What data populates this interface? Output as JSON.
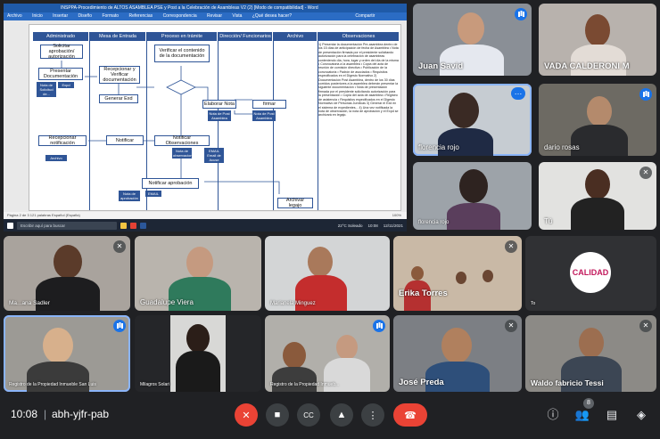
{
  "shared_screen": {
    "window_title": "INSPPA-Procedimiento de ALTOS ASAMBLEA PSE y Post a la Celebración de Asambleas V2 (2) [Modo de compatibilidad] - Word",
    "ribbon_tabs": [
      "Archivo",
      "Inicio",
      "Insertar",
      "Diseño",
      "Formato",
      "Referencias",
      "Correspondencia",
      "Revisar",
      "Vista",
      "¿Qué desea hacer?",
      "Compartir"
    ],
    "columns": [
      "Administrado",
      "Mesa de Entrada",
      "Proceso en trámite",
      "Dirección/ Funcionarios",
      "Archivo",
      "Observaciones"
    ],
    "boxes": {
      "solicitar": "Solicitar aprobación/ autorización",
      "presentar": "Presentar Documentación",
      "recepcionar": "Recepcionar y Verificar documentación",
      "generar": "Generar Exd",
      "verificar": "Verificar el contenido de la documentación",
      "cumple": "¿Cumple?",
      "elaborar": "Elaborar Nota",
      "firmar": "firmar",
      "notificar": "Notificar",
      "notificar_obs": "Notificar Observaciones",
      "recepcionar_notif": "Recepcionar notificación",
      "notificar_aprob": "Notificar aprobación",
      "archivar": "Archivar legajo"
    },
    "minis": {
      "nota_post": "Nota de Post Asamblea",
      "nota_post2": "Nota de Post Asamblea",
      "nota_sol": "Nota de Solicitud de...",
      "nota_obs": "Nota de observaciones",
      "email": "EMAIL Email de Acuse",
      "expd": "Expd",
      "archivo": "Archivo",
      "email2": "EMAIL",
      "nota_aprob": "Nota de aprobación"
    },
    "observaciones_title": "Observaciones",
    "observaciones_text": "1) Presentar la documentación Pre-asamblea dentro de los 15 días de anticipación de fecha de Asamblea • Nota de presentación firmada por el presidente solicitando autorización para la celebración de asambleas conteniendo día, hora, lugar y orden del día de la misma • Convocatoria a la asamblea • Copia del acta de reunión de comisión directiva • Publicación de la convocatoria • Padrón de asociados • Requisitos especificados en el Digesto Normativo 2) Documentación Post Asamblea, dentro de los 30 días corridos posteriores a la asamblea deberán presentar la siguiente documentación • Nota de presentación firmada por el presidente solicitando autorización para la presentación • Copia del acta de asamblea • Registro de asistencia • Requisitos especificados en el Digesto Normativo de Personas Jurídicas 3) Generar el Exd en el sistema de expedientes... 4) Una vez notificada la nota de observación, la nota de aprobación y el Expd se archivará en legajo.",
    "status_left": "Página 2 de 3   121 palabras   Español (España)",
    "status_right": "100%",
    "taskbar_search": "Escribir aquí para buscar",
    "taskbar_weather": "22°C Soleado",
    "taskbar_time": "10:08",
    "taskbar_date": "12/11/2021"
  },
  "participants": {
    "juan": "Juan Savid",
    "vada": "VADA CALDERONI M",
    "florencia": "florencia rojo",
    "dario": "dario rosas",
    "florencia2": "florencia rojo",
    "tu": "Tú",
    "sadler": "Ma...ana Sadler",
    "guadalupe": "Guadalupe Viera",
    "marianela": "Marianela Minguez",
    "erika": "Erika Torres",
    "calidad": "CALIDAD",
    "calidad_caption": "To",
    "registro1": "Registro de la Propiedad Inmueble San Luis",
    "milagros": "Milagros Solari",
    "registro2": "Registro de la Propiedad Inmueb...",
    "jose": "José Preda",
    "waldo": "Waldo fabricio Tessi"
  },
  "bottom_bar": {
    "time": "10:08",
    "separator": "|",
    "meeting_code": "abh-yjfr-pab",
    "participant_count": "8"
  },
  "colors": {
    "meet_bg": "#202124",
    "hangup": "#ea4335",
    "accent": "#1a73e8",
    "flow_blue": "#2f5597"
  },
  "icons": [
    "mic-off-icon",
    "camera-icon",
    "captions-icon",
    "present-icon",
    "more-icon",
    "hangup-icon",
    "info-icon",
    "people-icon",
    "chat-icon",
    "activities-icon"
  ]
}
